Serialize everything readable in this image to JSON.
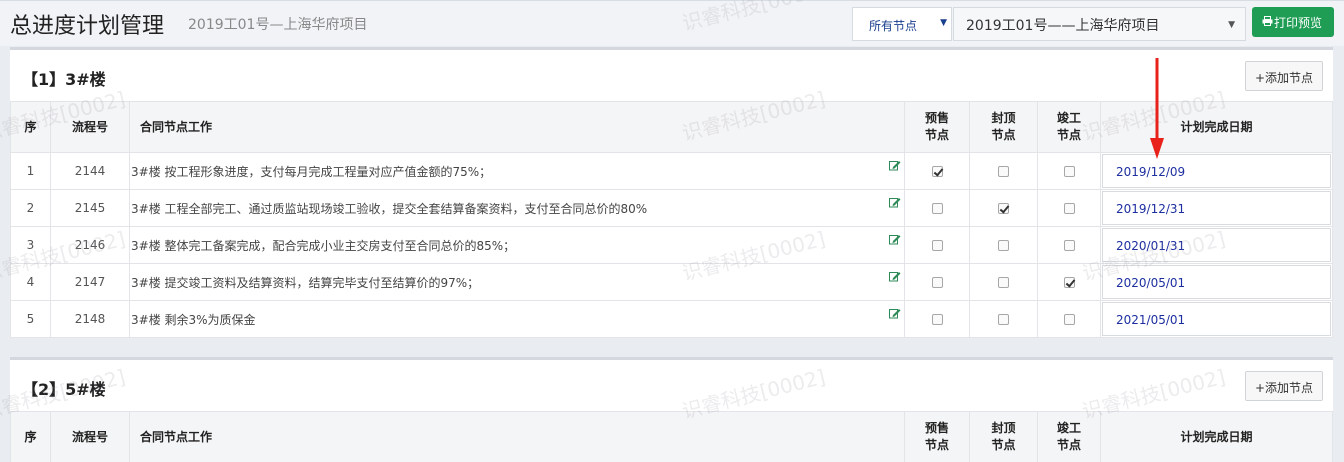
{
  "header": {
    "title": "总进度计划管理",
    "subtitle": "2019工01号—上海华府项目",
    "node_filter": "所有节点",
    "project": "2019工01号——上海华府项目",
    "print_label": "打印预览"
  },
  "colors": {
    "accent_green": "#1f9d55",
    "date_blue": "#1d2fa0",
    "arrow_red": "#e8211a"
  },
  "columns": {
    "seq": "序",
    "flow": "流程号",
    "work": "合同节点工作",
    "presale_a": "预售",
    "presale_b": "节点",
    "capping_a": "封顶",
    "capping_b": "节点",
    "complete_a": "竣工",
    "complete_b": "节点",
    "plan_date": "计划完成日期"
  },
  "sections": [
    {
      "title": "【1】3#楼",
      "add_label": "+添加节点",
      "rows": [
        {
          "seq": "1",
          "flow": "2144",
          "work": "3#楼 按工程形象进度，支付每月完成工程量对应产值金额的75%；",
          "presale": true,
          "capping": false,
          "complete": false,
          "date": "2019/12/09"
        },
        {
          "seq": "2",
          "flow": "2145",
          "work": "3#楼 工程全部完工、通过质监站现场竣工验收，提交全套结算备案资料，支付至合同总价的80%",
          "presale": false,
          "capping": true,
          "complete": false,
          "date": "2019/12/31"
        },
        {
          "seq": "3",
          "flow": "2146",
          "work": "3#楼 整体完工备案完成，配合完成小业主交房支付至合同总价的85%；",
          "presale": false,
          "capping": false,
          "complete": false,
          "date": "2020/01/31"
        },
        {
          "seq": "4",
          "flow": "2147",
          "work": "3#楼 提交竣工资料及结算资料，结算完毕支付至结算价的97%；",
          "presale": false,
          "capping": false,
          "complete": true,
          "date": "2020/05/01"
        },
        {
          "seq": "5",
          "flow": "2148",
          "work": "3#楼 剩余3%为质保金",
          "presale": false,
          "capping": false,
          "complete": false,
          "date": "2021/05/01"
        }
      ]
    },
    {
      "title": "【2】5#楼",
      "add_label": "+添加节点",
      "rows": []
    }
  ],
  "watermark": "识睿科技[0002]"
}
